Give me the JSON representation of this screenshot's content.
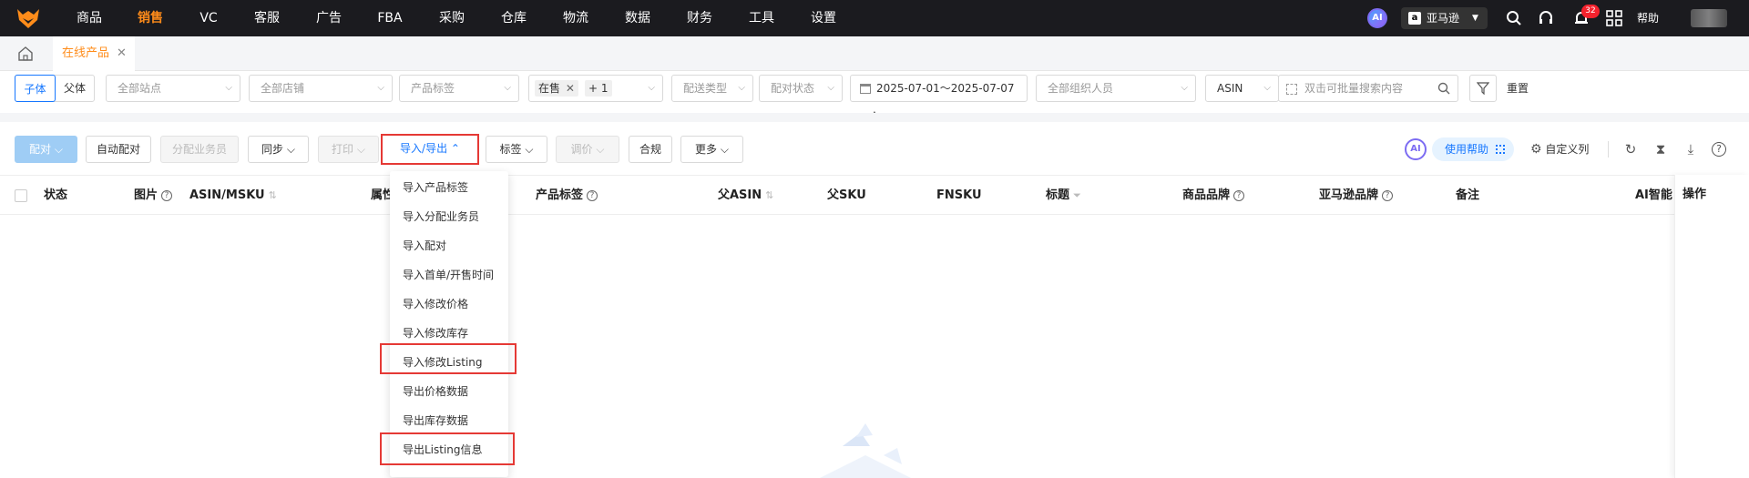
{
  "topnav": {
    "items": [
      "商品",
      "销售",
      "VC",
      "客服",
      "广告",
      "FBA",
      "采购",
      "仓库",
      "物流",
      "数据",
      "财务",
      "工具",
      "设置"
    ],
    "active": "销售",
    "ai_label": "AI",
    "marketplace": "亚马逊",
    "notification_count": "32",
    "help_label": "帮助"
  },
  "tabs": {
    "current": "在线产品"
  },
  "filters": {
    "child_label": "子体",
    "parent_label": "父体",
    "site_placeholder": "全部站点",
    "store_placeholder": "全部店铺",
    "product_tag_placeholder": "产品标签",
    "status_chip": "在售",
    "status_more": "+ 1",
    "delivery_placeholder": "配送类型",
    "pair_status_placeholder": "配对状态",
    "date_range": "2025-07-01～2025-07-07",
    "org_placeholder": "全部组织人员",
    "search_field": "ASIN",
    "search_placeholder": "双击可批量搜索内容",
    "reset_label": "重置"
  },
  "toolbar": {
    "pair": "配对",
    "auto_pair": "自动配对",
    "assign_salesman": "分配业务员",
    "sync": "同步",
    "print": "打印",
    "import_export": "导入/导出",
    "tags": "标签",
    "adjust_price": "调价",
    "compliance": "合规",
    "more": "更多",
    "ai_label": "AI",
    "use_help": "使用帮助",
    "custom_columns": "自定义列"
  },
  "dropdown": {
    "items": [
      "导入产品标签",
      "导入分配业务员",
      "导入配对",
      "导入首单/开售时间",
      "导入修改价格",
      "导入修改库存",
      "导入修改Listing",
      "导出价格数据",
      "导出库存数据",
      "导出Listing信息"
    ]
  },
  "table": {
    "headers": {
      "status": "状态",
      "image": "图片",
      "asin_msku": "ASIN/MSKU",
      "attribute": "属性",
      "product_tag": "产品标签",
      "parent_asin": "父ASIN",
      "parent_sku": "父SKU",
      "fnsku": "FNSKU",
      "title": "标题",
      "product_brand": "商品品牌",
      "amazon_brand": "亚马逊品牌",
      "remark": "备注",
      "ai_smart": "AI智能",
      "action": "操作"
    }
  },
  "colors": {
    "accent": "#ff8c1a",
    "primary": "#1677ff",
    "highlight": "#e53935",
    "topbar": "#1b1b1f"
  }
}
